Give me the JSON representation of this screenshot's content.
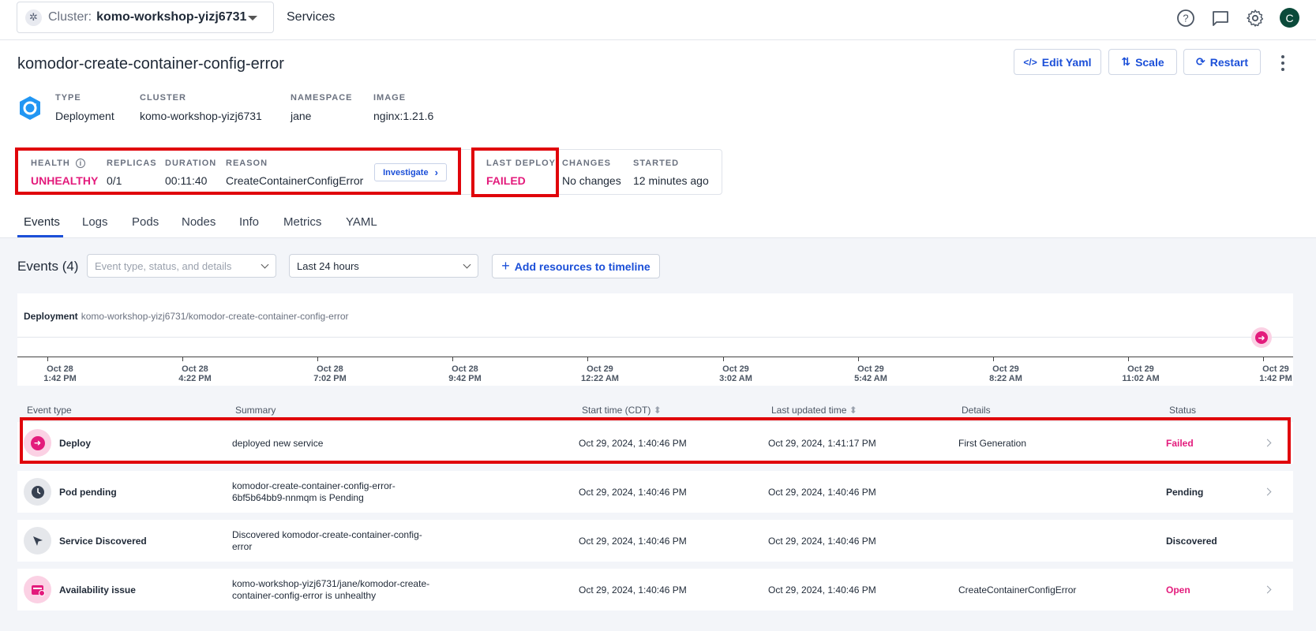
{
  "topbar": {
    "cluster_label": "Cluster:",
    "cluster_value": "komo-workshop-yizj6731",
    "services_link": "Services",
    "avatar_initial": "C"
  },
  "header": {
    "title": "komodor-create-container-config-error",
    "buttons": {
      "edit_yaml": "Edit Yaml",
      "scale": "Scale",
      "restart": "Restart"
    }
  },
  "meta": {
    "type_label": "TYPE",
    "type_value": "Deployment",
    "cluster_label": "CLUSTER",
    "cluster_value": "komo-workshop-yizj6731",
    "namespace_label": "NAMESPACE",
    "namespace_value": "jane",
    "image_label": "IMAGE",
    "image_value": "nginx:1.21.6"
  },
  "status": {
    "health_label": "HEALTH",
    "health_value": "UNHEALTHY",
    "replicas_label": "REPLICAS",
    "replicas_value": "0/1",
    "duration_label": "DURATION",
    "duration_value": "00:11:40",
    "reason_label": "REASON",
    "reason_value": "CreateContainerConfigError",
    "investigate_label": "Investigate",
    "last_deploy_label": "LAST DEPLOY",
    "last_deploy_value": "FAILED",
    "changes_label": "CHANGES",
    "changes_value": "No changes",
    "started_label": "STARTED",
    "started_value": "12 minutes ago"
  },
  "tabs": [
    "Events",
    "Logs",
    "Pods",
    "Nodes",
    "Info",
    "Metrics",
    "YAML"
  ],
  "events": {
    "title": "Events (4)",
    "filter_placeholder": "Event type, status, and details",
    "time_range": "Last 24 hours",
    "add_resources": "Add resources to timeline"
  },
  "timeline": {
    "kind": "Deployment",
    "path": "komo-workshop-yizj6731/komodor-create-container-config-error",
    "ticks": [
      {
        "date": "Oct 28",
        "time": "1:42 PM"
      },
      {
        "date": "Oct 28",
        "time": "4:22 PM"
      },
      {
        "date": "Oct 28",
        "time": "7:02 PM"
      },
      {
        "date": "Oct 28",
        "time": "9:42 PM"
      },
      {
        "date": "Oct 29",
        "time": "12:22 AM"
      },
      {
        "date": "Oct 29",
        "time": "3:02 AM"
      },
      {
        "date": "Oct 29",
        "time": "5:42 AM"
      },
      {
        "date": "Oct 29",
        "time": "8:22 AM"
      },
      {
        "date": "Oct 29",
        "time": "11:02 AM"
      },
      {
        "date": "Oct 29",
        "time": "1:42 PM"
      }
    ]
  },
  "table": {
    "headers": {
      "event_type": "Event type",
      "summary": "Summary",
      "start_time": "Start time (CDT)",
      "last_updated": "Last updated time",
      "details": "Details",
      "status": "Status"
    },
    "rows": [
      {
        "event_type": "Deploy",
        "summary1": "deployed new service",
        "summary2": "",
        "start": "Oct 29, 2024, 1:40:46 PM",
        "updated": "Oct 29, 2024, 1:41:17 PM",
        "details": "First Generation",
        "status": "Failed"
      },
      {
        "event_type": "Pod pending",
        "summary1": "komodor-create-container-config-error-",
        "summary2": "6bf5b64bb9-nnmqm is Pending",
        "start": "Oct 29, 2024, 1:40:46 PM",
        "updated": "Oct 29, 2024, 1:40:46 PM",
        "details": "",
        "status": "Pending"
      },
      {
        "event_type": "Service Discovered",
        "summary1": "Discovered komodor-create-container-config-",
        "summary2": "error",
        "start": "Oct 29, 2024, 1:40:46 PM",
        "updated": "Oct 29, 2024, 1:40:46 PM",
        "details": "",
        "status": "Discovered"
      },
      {
        "event_type": "Availability issue",
        "summary1": "komo-workshop-yizj6731/jane/komodor-create-",
        "summary2": "container-config-error is unhealthy",
        "start": "Oct 29, 2024, 1:40:46 PM",
        "updated": "Oct 29, 2024, 1:40:46 PM",
        "details": "CreateContainerConfigError",
        "status": "Open"
      }
    ]
  },
  "colors": {
    "accent": "#1b4fd8",
    "danger_pink": "#e31b7c",
    "highlight_red": "#e0040b"
  }
}
